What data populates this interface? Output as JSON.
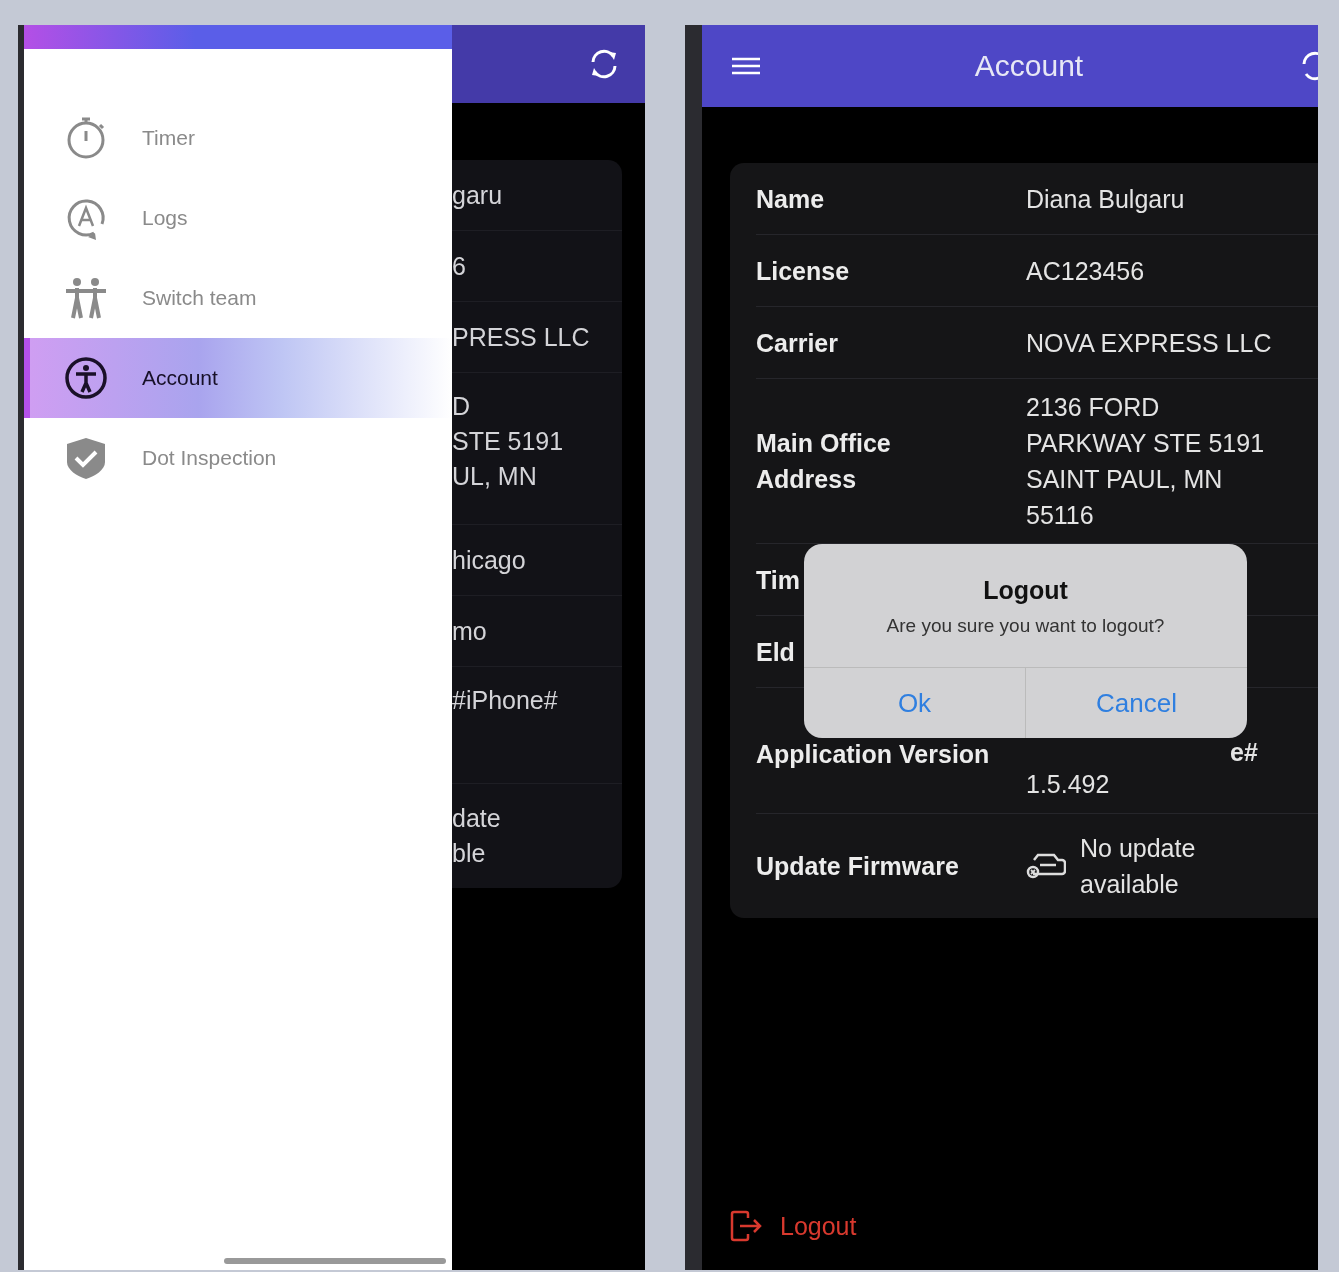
{
  "left_screen": {
    "drawer_items": [
      {
        "kind": "timer",
        "label": "Timer",
        "selected": false
      },
      {
        "kind": "logs",
        "label": "Logs",
        "selected": false
      },
      {
        "kind": "team",
        "label": "Switch team",
        "selected": false
      },
      {
        "kind": "account",
        "label": "Account",
        "selected": true
      },
      {
        "kind": "inspection",
        "label": "Dot Inspection",
        "selected": false
      }
    ],
    "background_rows": [
      {
        "lines": [
          "garu"
        ]
      },
      {
        "lines": [
          "6"
        ]
      },
      {
        "lines": [
          "PRESS LLC"
        ]
      },
      {
        "lines": [
          "D",
          "STE 5191",
          "UL, MN"
        ],
        "tall": true
      },
      {
        "lines": [
          "hicago"
        ]
      },
      {
        "lines": [
          "mo"
        ]
      },
      {
        "lines": [
          "#iPhone#"
        ],
        "tall": true
      },
      {
        "lines": [
          "date",
          "ble"
        ]
      }
    ]
  },
  "right_screen": {
    "header": {
      "title": "Account"
    },
    "details": [
      {
        "label_lines": [
          "Name"
        ],
        "value_lines": [
          "Diana Bulgaru"
        ]
      },
      {
        "label_lines": [
          "License"
        ],
        "value_lines": [
          "AC123456"
        ]
      },
      {
        "label_lines": [
          "Carrier"
        ],
        "value_lines": [
          "NOVA EXPRESS LLC"
        ]
      },
      {
        "label_lines": [
          "Main Office",
          "Address"
        ],
        "value_lines": [
          "2136 FORD",
          "PARKWAY STE 5191",
          "SAINT PAUL, MN",
          "55116"
        ]
      },
      {
        "label_lines": [
          "Tim"
        ]
      },
      {
        "label_lines": [
          "Eld"
        ]
      },
      {
        "label_lines": [
          "Application Version"
        ],
        "value_lines": [
          "e#",
          "1.5.492"
        ],
        "first_value_partial": true
      },
      {
        "label_lines": [
          "Update Firmware"
        ],
        "value_lines": [
          "No update",
          "available"
        ],
        "kind": "firmware"
      }
    ],
    "dialog": {
      "title": "Logout",
      "message": "Are you sure you want to logout?",
      "buttons": [
        "Ok",
        "Cancel"
      ]
    },
    "logout": {
      "label": "Logout"
    }
  }
}
